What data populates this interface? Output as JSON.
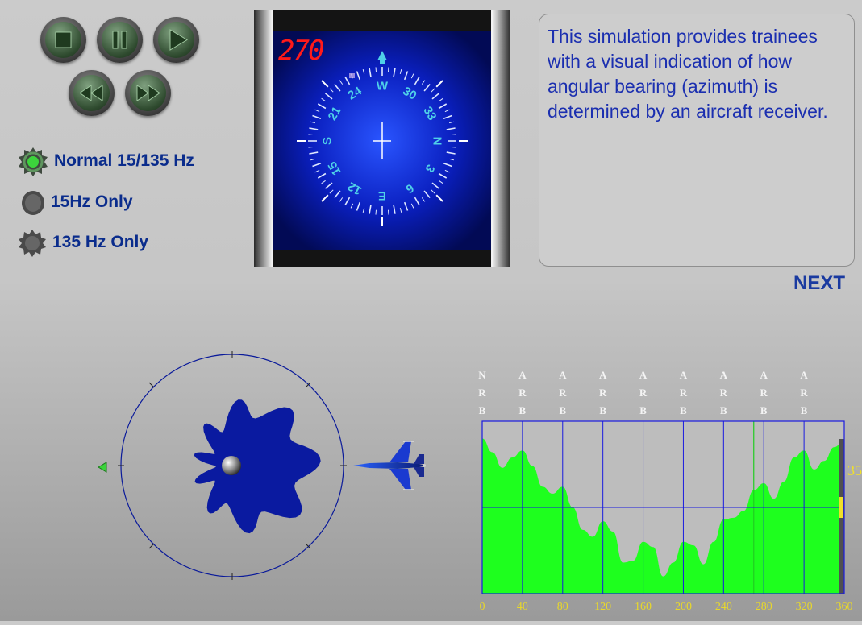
{
  "controls": {
    "stop": "stop",
    "pause": "pause",
    "play": "play",
    "rewind": "rewind",
    "fast_forward": "fast-forward"
  },
  "modes": [
    {
      "label": "Normal 15/135 Hz",
      "selected": true
    },
    {
      "label": "15Hz Only",
      "selected": false
    },
    {
      "label": "135 Hz Only",
      "selected": false
    }
  ],
  "indicator": {
    "heading_readout": "270",
    "compass_labels": {
      "n": "N",
      "e": "E",
      "s": "S",
      "w": "W",
      "c3": "3",
      "c6": "6",
      "c12": "12",
      "c15": "15",
      "c21": "21",
      "c24": "24",
      "c30": "30",
      "c33": "33"
    }
  },
  "description": "This simulation provides trainees with a visual indication of how angular bearing (azimuth) is determined by an aircraft receiver.",
  "next_label": "NEXT",
  "chart_data": {
    "type": "area",
    "x_ticks": [
      0,
      40,
      80,
      120,
      160,
      200,
      240,
      280,
      320,
      360
    ],
    "column_labels": [
      "NRB",
      "ARB",
      "ARB",
      "ARB",
      "ARB",
      "ARB",
      "ARB",
      "ARB",
      "ARB"
    ],
    "xlim": [
      0,
      360
    ],
    "ylim": [
      0,
      1
    ],
    "grid": true,
    "marker_x": 270,
    "side_value": "35",
    "x": [
      0,
      10,
      20,
      30,
      40,
      50,
      60,
      70,
      80,
      90,
      100,
      110,
      120,
      130,
      140,
      150,
      160,
      170,
      180,
      190,
      200,
      210,
      220,
      230,
      240,
      250,
      260,
      270,
      280,
      290,
      300,
      310,
      320,
      330,
      340,
      350,
      360
    ],
    "y": [
      0.9,
      0.82,
      0.73,
      0.79,
      0.83,
      0.74,
      0.62,
      0.58,
      0.62,
      0.5,
      0.37,
      0.33,
      0.42,
      0.36,
      0.18,
      0.19,
      0.3,
      0.27,
      0.1,
      0.18,
      0.3,
      0.28,
      0.17,
      0.3,
      0.43,
      0.44,
      0.48,
      0.6,
      0.64,
      0.55,
      0.65,
      0.79,
      0.83,
      0.72,
      0.77,
      0.85,
      0.89
    ]
  }
}
